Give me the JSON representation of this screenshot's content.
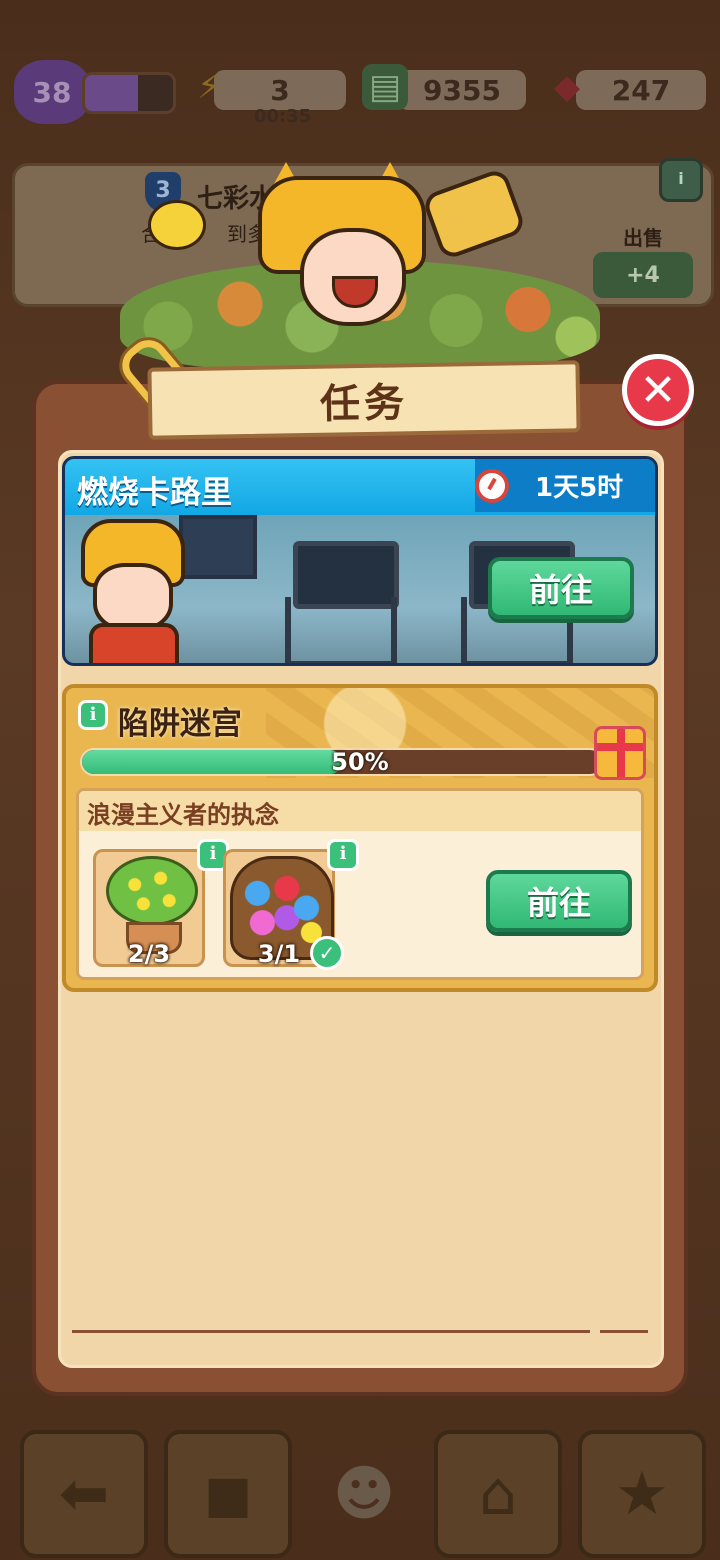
{
  "hud": {
    "level": "38",
    "energy": "3",
    "energy_timer": "00:35",
    "cash": "9355",
    "gems": "247"
  },
  "background_banner": {
    "rank": "3",
    "title": "七彩水晶",
    "subtitle": "合",
    "subtitle_tail": "到多",
    "sell_label": "出售",
    "sell_value": "+4"
  },
  "modal": {
    "title": "任务",
    "close_icon": "close-icon"
  },
  "task1": {
    "title": "燃烧卡路里",
    "timer": "1天5时",
    "go_label": "前往",
    "accent": "#12a7e5"
  },
  "task2": {
    "title": "陷阱迷宫",
    "progress": 0.5,
    "progress_text": "50%",
    "subtask": {
      "title": "浪漫主义者的执念",
      "items": [
        {
          "icon": "potted-plant-icon",
          "count": "2/3",
          "complete": false
        },
        {
          "icon": "flower-basket-icon",
          "count": "3/1",
          "complete": true
        }
      ],
      "go_label": "前往"
    }
  },
  "colors": {
    "go_button": "#31b874",
    "close_button": "#e8394a",
    "modal_frame": "#8a5034",
    "modal_paper": "#f0d6a8"
  }
}
